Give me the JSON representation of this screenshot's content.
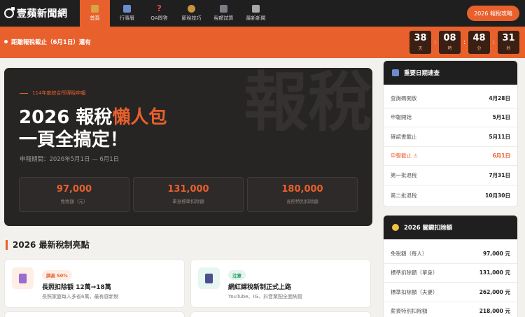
{
  "brand": {
    "name": "壹蘋新聞網",
    "accent": "#e8602c",
    "dark": "#1f1f1f"
  },
  "nav": {
    "items": [
      {
        "label": "首頁",
        "icon": "home-icon",
        "active": true
      },
      {
        "label": "行事曆",
        "icon": "calendar-icon",
        "active": false
      },
      {
        "label": "QA問答",
        "icon": "question-icon",
        "active": false
      },
      {
        "label": "節稅技巧",
        "icon": "moneybag-icon",
        "active": false
      },
      {
        "label": "稅額試算",
        "icon": "calculator-icon",
        "active": false
      },
      {
        "label": "最新新聞",
        "icon": "newspaper-icon",
        "active": false
      }
    ],
    "cta_label": "2026 報稅攻略"
  },
  "countdown": {
    "label": "距離報稅截止（6月1日）還有",
    "units": [
      {
        "value": "38",
        "unit": "天"
      },
      {
        "value": "08",
        "unit": "時"
      },
      {
        "value": "48",
        "unit": "分"
      },
      {
        "value": "31",
        "unit": "秒"
      }
    ]
  },
  "hero": {
    "eyebrow": "114年度綜合所得稅申報",
    "title_prefix": "2026 報稅",
    "title_accent": "懶人包",
    "title_line2": "一頁全搞定！",
    "period": "申報期間：2026年5月1日 — 6月1日",
    "bg_text": "報稅",
    "stats": [
      {
        "value": "97,000",
        "label": "免稅額（元）"
      },
      {
        "value": "131,000",
        "label": "單身標準扣除額"
      },
      {
        "value": "180,000",
        "label": "長照特別扣除額"
      }
    ]
  },
  "section": {
    "title": "2026 最新稅制亮點"
  },
  "cards": [
    {
      "badge": "調高 50%",
      "title": "長照扣除額 12萬→18萬",
      "sub": "長照家庭每人多省6萬，最有感新制",
      "icon": "document-icon",
      "badge_color": "#e8602c",
      "badge_bg": "#fdeee6",
      "icon_bg": "#fdeee6"
    },
    {
      "badge": "注意",
      "title": "網紅課稅新制正式上路",
      "sub": "YouTube、IG、抖音業配全面納管",
      "icon": "phone-icon",
      "badge_color": "#2a9a6b",
      "badge_bg": "#e3f5ec",
      "icon_bg": "#e6f6f0"
    }
  ],
  "dates_panel": {
    "title": "重要日期速查",
    "icon": "calendar-icon",
    "rows": [
      {
        "label": "查詢碼開放",
        "value": "4月28日",
        "highlight": false
      },
      {
        "label": "申報開始",
        "value": "5月1日",
        "highlight": false
      },
      {
        "label": "確認書截止",
        "value": "5月11日",
        "highlight": false
      },
      {
        "label": "申報截止 ⚠",
        "value": "6月1日",
        "highlight": true
      },
      {
        "label": "第一批退稅",
        "value": "7月31日",
        "highlight": false
      },
      {
        "label": "第二批退稅",
        "value": "10月30日",
        "highlight": false
      }
    ]
  },
  "deduction_panel": {
    "title": "2026 關鍵扣除額",
    "icon": "lightbulb-icon",
    "rows": [
      {
        "label": "免稅額（每人）",
        "value": "97,000 元"
      },
      {
        "label": "標準扣除額（單身）",
        "value": "131,000 元"
      },
      {
        "label": "標準扣除額（夫妻）",
        "value": "262,000 元"
      },
      {
        "label": "薪資特別扣除額",
        "value": "218,000 元"
      }
    ]
  }
}
